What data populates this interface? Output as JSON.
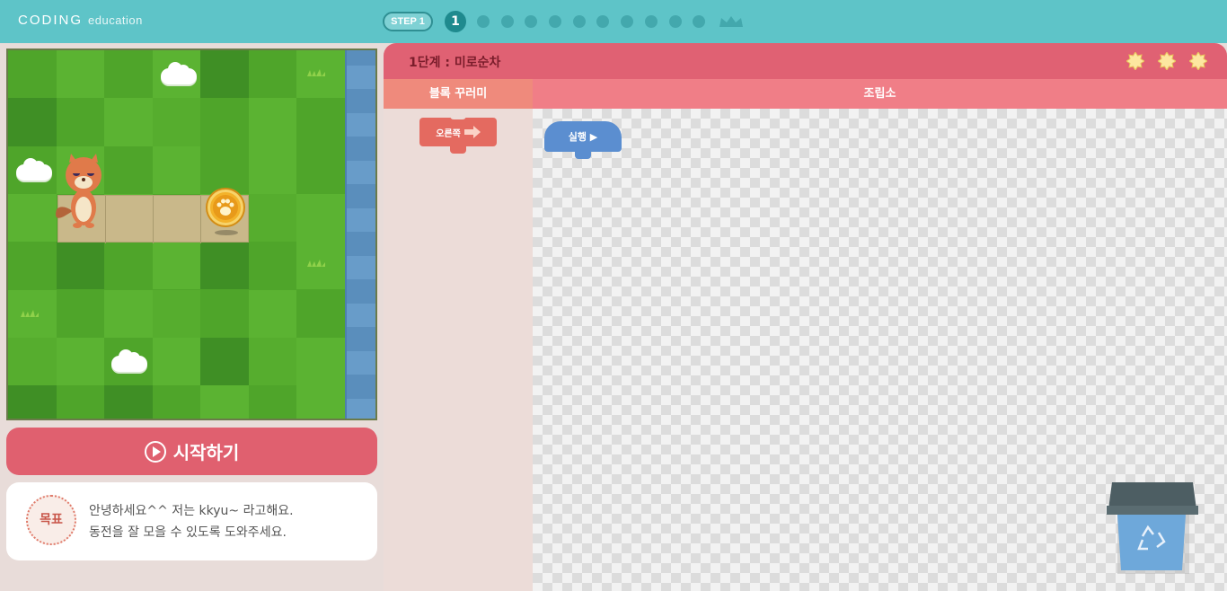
{
  "header": {
    "logo_main": "CODING",
    "logo_sub": "education",
    "step_label": "STEP 1",
    "current_step": "1",
    "total_step_dots": 11
  },
  "game": {
    "start_button_label": "시작하기",
    "goal_badge": "목표",
    "goal_line1": "안녕하세요^^ 저는 kkyu~ 라고해요.",
    "goal_line2": "동전을 잘 모을 수 있도록 도와주세요."
  },
  "panel": {
    "title": "1단계 : 미로순차",
    "stars": 3,
    "palette_header": "블록 꾸러미",
    "workspace_header": "조립소",
    "palette_blocks": [
      {
        "label": "오른쪽",
        "icon": "right-arrow-icon"
      }
    ],
    "workspace_blocks": [
      {
        "label": "실행 ▶"
      }
    ]
  },
  "colors": {
    "topbar": "#5ec4c8",
    "panel_header": "#e06173",
    "start_button": "#e0606f",
    "move_block": "#e46a60",
    "run_block": "#5b8ed0"
  }
}
